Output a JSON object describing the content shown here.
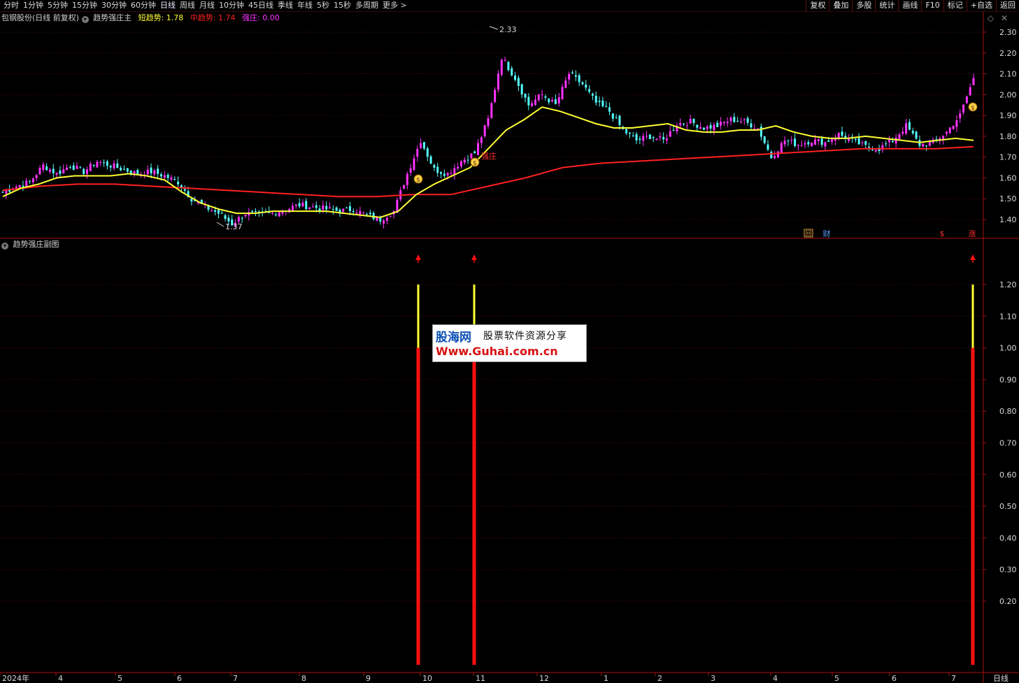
{
  "toolbar": {
    "periods": [
      "分时",
      "1分钟",
      "5分钟",
      "15分钟",
      "30分钟",
      "60分钟",
      "日线",
      "周线",
      "月线",
      "10分钟",
      "45日线",
      "季线",
      "年线",
      "5秒",
      "15秒",
      "多周期",
      "更多 >"
    ],
    "active_period": "日线",
    "right_buttons": [
      "复权",
      "叠加",
      "多股",
      "统计",
      "画线",
      "F10",
      "标记",
      "+自选",
      "返回"
    ]
  },
  "main_legend": {
    "title": "包钢股份(日线 前复权)",
    "indicator": "趋势强庄主",
    "items": [
      {
        "label": "短趋势: 1.78",
        "color": "#ffff33"
      },
      {
        "label": "中趋势: 1.74",
        "color": "#ff2020"
      },
      {
        "label": "强庄: 0.00",
        "color": "#ff33ff"
      }
    ]
  },
  "sub_legend": {
    "title": "趋势强庄副图"
  },
  "markers": {
    "high_label": "2.33",
    "low_label": "1.37",
    "strong_label": "强庄",
    "icon_hui": "回",
    "icon_cai": "财",
    "icon_dollar": "$",
    "icon_zhang": "涨"
  },
  "watermark": {
    "line1": "股海网",
    "line1_right": "股票软件资源分享",
    "line2": "Www.Guhai.com.cn"
  },
  "bottom_right_label": "日线",
  "colors": {
    "up": "#ff33ff",
    "down": "#55ffff",
    "short_trend": "#ffff33",
    "mid_trend": "#ff2020",
    "axis": "#aa1010",
    "grid": "#5a1010"
  },
  "chart_data": [
    {
      "type": "line",
      "title": "包钢股份(日线 前复权)",
      "ylim": [
        1.35,
        2.38
      ],
      "y_ticks": [
        1.4,
        1.5,
        1.6,
        1.7,
        1.8,
        1.9,
        2.0,
        2.1,
        2.2,
        2.3
      ],
      "x_tick_labels": [
        "2024年",
        "4",
        "5",
        "6",
        "7",
        "8",
        "9",
        "10",
        "11",
        "12",
        "1",
        "2",
        "3",
        "4",
        "5",
        "6",
        "7"
      ],
      "series": [
        {
          "name": "收盘",
          "values": [
            1.53,
            1.56,
            1.58,
            1.66,
            1.62,
            1.66,
            1.63,
            1.68,
            1.66,
            1.64,
            1.62,
            1.63,
            1.61,
            1.58,
            1.5,
            1.46,
            1.43,
            1.38,
            1.43,
            1.42,
            1.43,
            1.45,
            1.47,
            1.46,
            1.45,
            1.44,
            1.45,
            1.42,
            1.4,
            1.44,
            1.62,
            1.78,
            1.64,
            1.62,
            1.68,
            1.72,
            1.88,
            2.18,
            2.08,
            1.95,
            2.0,
            1.95,
            2.1,
            2.05,
            1.96,
            1.92,
            1.83,
            1.78,
            1.8,
            1.78,
            1.86,
            1.87,
            1.84,
            1.85,
            1.88,
            1.87,
            1.84,
            1.7,
            1.78,
            1.76,
            1.78,
            1.77,
            1.81,
            1.78,
            1.75,
            1.74,
            1.78,
            1.85,
            1.76,
            1.77,
            1.82,
            1.9,
            2.08
          ]
        },
        {
          "name": "短趋势",
          "values": [
            1.51,
            1.55,
            1.57,
            1.6,
            1.61,
            1.61,
            1.61,
            1.62,
            1.61,
            1.59,
            1.53,
            1.48,
            1.45,
            1.43,
            1.43,
            1.44,
            1.44,
            1.44,
            1.44,
            1.43,
            1.42,
            1.41,
            1.44,
            1.52,
            1.57,
            1.61,
            1.65,
            1.74,
            1.83,
            1.88,
            1.94,
            1.92,
            1.89,
            1.86,
            1.84,
            1.84,
            1.85,
            1.86,
            1.83,
            1.82,
            1.82,
            1.83,
            1.83,
            1.85,
            1.82,
            1.8,
            1.79,
            1.79,
            1.8,
            1.79,
            1.78,
            1.77,
            1.78,
            1.79,
            1.78
          ]
        },
        {
          "name": "中趋势",
          "values": [
            1.54,
            1.56,
            1.57,
            1.57,
            1.56,
            1.55,
            1.54,
            1.53,
            1.52,
            1.51,
            1.51,
            1.52,
            1.52,
            1.56,
            1.6,
            1.65,
            1.67,
            1.68,
            1.69,
            1.7,
            1.71,
            1.72,
            1.73,
            1.74,
            1.74,
            1.74,
            1.75
          ]
        }
      ]
    },
    {
      "type": "bar",
      "title": "趋势强庄副图",
      "ylim": [
        0,
        1.33
      ],
      "y_ticks": [
        0.2,
        0.3,
        0.4,
        0.5,
        0.6,
        0.7,
        0.8,
        0.9,
        1.0,
        1.1,
        1.2
      ],
      "signals": [
        {
          "date": "2024-09",
          "value": 1.2
        },
        {
          "date": "2024-10",
          "value": 1.2
        },
        {
          "date": "2025-07",
          "value": 1.2
        }
      ]
    }
  ]
}
